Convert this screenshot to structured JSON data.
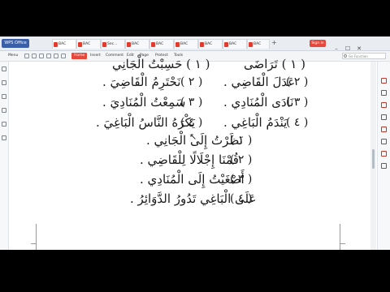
{
  "tabbar": {
    "home_label": "WPS Office",
    "tabs": [
      {
        "label": "BAC"
      },
      {
        "label": "BAC"
      },
      {
        "label": "Sec..."
      },
      {
        "label": "BAC"
      },
      {
        "label": "BAC"
      },
      {
        "label": "BAC"
      },
      {
        "label": "BAC"
      },
      {
        "label": "BAC"
      },
      {
        "label": "BAC"
      }
    ],
    "signin_label": "Sign in",
    "window_controls": [
      "–",
      "☐",
      "✕"
    ]
  },
  "menubar": {
    "menu_label": "Menu",
    "items": [
      "Home",
      "Insert",
      "Comment",
      "Edit",
      "Page",
      "Protect",
      "Tools"
    ],
    "active_item": "Home",
    "search_placeholder": "Go Function"
  },
  "document": {
    "left_column": [
      {
        "num": "( ٢ )",
        "text": "عَدَلَ الْقَاضِي ."
      },
      {
        "num": "( ٣ )",
        "text": "نَادَى الْمُنَادِي ."
      },
      {
        "num": "( ٤ )",
        "text": "يَنْدَمُ الْبَاغِي ."
      }
    ],
    "right_column": [
      {
        "num": "( ٢ )",
        "text": "نَحْتَرِمُ الْقَاضِيَ ."
      },
      {
        "num": "( ٣ )",
        "text": "سَمِعْتُ الْمُنَادِيَ ."
      },
      {
        "num": "( ٤ )",
        "text": "يَكْرَهُ النَّاسُ الْبَاغِيَ ."
      }
    ],
    "top_partial_left": "( ١ ) تَرَاضَى",
    "top_partial_right": "( ١ ) حَسِبْتُ الْجَانِي",
    "center_column": [
      {
        "num": "( ١ )",
        "text": "نَظَرْتُ إِلَى الْجَانِي ."
      },
      {
        "num": "( ٢ )",
        "text": "قُمْنَا إِجْلَالًا لِلْقَاضِي ."
      },
      {
        "num": "( ٣ )",
        "text": "أَصْغَيْتُ إِلَى الْمُنَادِي ."
      },
      {
        "num": "( ٤ )",
        "text": "عَلَى الْبَاغِي تَدُورُ الدَّوَائِرُ ."
      }
    ]
  }
}
